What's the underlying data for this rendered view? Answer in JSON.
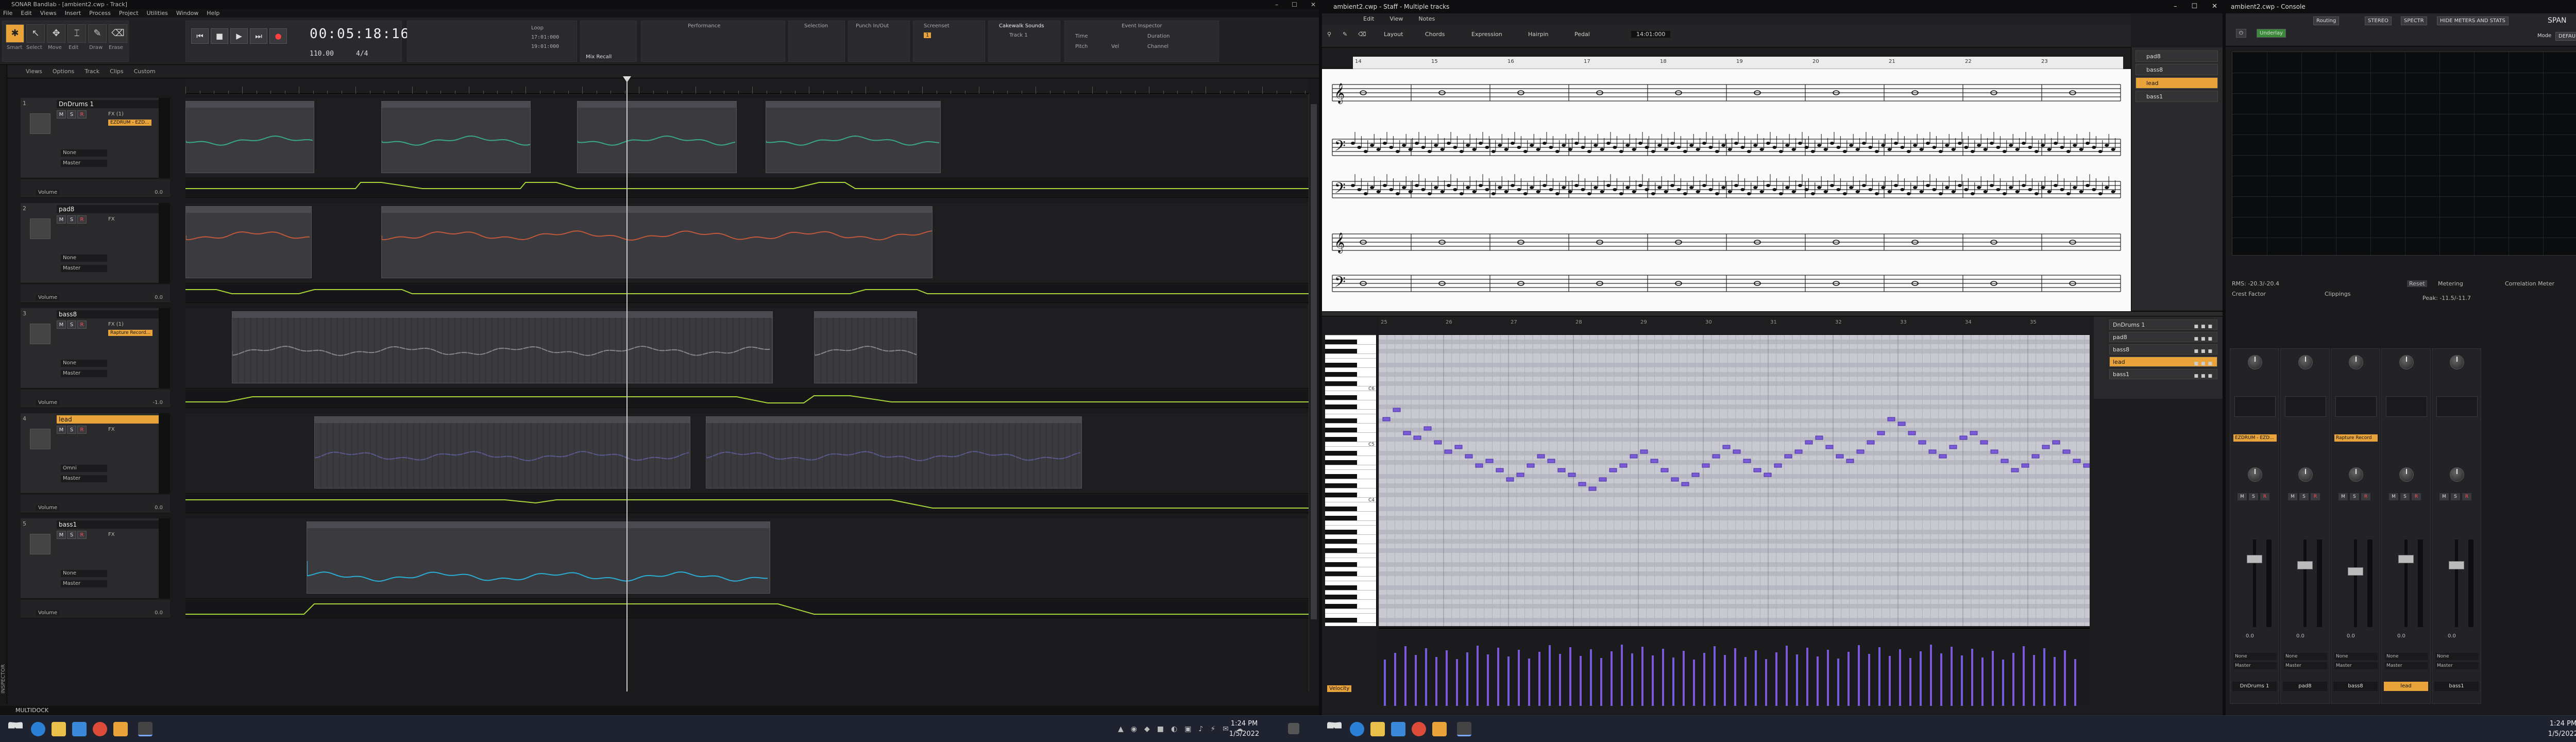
{
  "daw": {
    "title": "SONAR Bandlab - [ambient2.cwp - Track]",
    "menu": [
      "File",
      "Edit",
      "Views",
      "Insert",
      "Process",
      "Project",
      "Utilities",
      "Window",
      "Help"
    ],
    "tools": {
      "smart": "Smart",
      "select": "Select",
      "move": "Move",
      "edit": "Edit",
      "draw": "Draw",
      "erase": "Erase"
    },
    "transport": {
      "time": "00:05:18:16",
      "tempo": "110.00",
      "meter": "4/4",
      "loop_label": "Loop",
      "loop_start": "17:01:000",
      "loop_end": "19:01:000"
    },
    "control": {
      "mix_recall": "Mix Recall",
      "performance": "Performance",
      "selection": "Selection",
      "punch": "Punch In/Out",
      "screenset": "Screenset",
      "screenset_val": "1",
      "cakewalk": "Cakewalk Sounds",
      "track_label": "Track 1",
      "event_inspector": "Event Inspector",
      "time_lbl": "Time",
      "duration_lbl": "Duration",
      "pitch_lbl": "Pitch",
      "channel_lbl": "Channel",
      "vel_lbl": "Vel"
    },
    "view_menu": [
      "Views",
      "Options",
      "Track",
      "Clips",
      "Custom"
    ],
    "tracks": [
      {
        "num": "1",
        "name": "DnDrums 1",
        "plugin": "EZDRUM - EZD...",
        "fx": "FX (1)",
        "input": "None",
        "output": "Master",
        "auto_label": "Volume",
        "auto_val": "0.0"
      },
      {
        "num": "2",
        "name": "pad8",
        "plugin": "",
        "fx": "FX",
        "input": "None",
        "output": "Master",
        "auto_label": "Volume",
        "auto_val": "0.0"
      },
      {
        "num": "3",
        "name": "bass8",
        "plugin": "Rapture Record...",
        "fx": "FX (1)",
        "input": "None",
        "output": "Master",
        "auto_label": "Volume",
        "auto_val": "-1.0"
      },
      {
        "num": "4",
        "name": "lead",
        "plugin": "",
        "fx": "FX",
        "input": "Omni",
        "output": "Master",
        "auto_label": "Volume",
        "auto_val": "0.0"
      },
      {
        "num": "5",
        "name": "bass1",
        "plugin": "",
        "fx": "FX",
        "input": "None",
        "output": "Master",
        "auto_label": "Volume",
        "auto_val": "0.0"
      }
    ],
    "msr": {
      "mute": "M",
      "solo": "S",
      "rec": "R"
    },
    "status": "MULTIDOCK",
    "inspector": "INSPECTOR"
  },
  "staff": {
    "title": "ambient2.cwp - Staff - Multiple tracks",
    "menu": [
      "Edit",
      "View",
      "Notes"
    ],
    "tools": {
      "layout": "Layout",
      "chords": "Chords",
      "expression": "Expression",
      "hairpin": "Hairpin",
      "pedal": "Pedal"
    },
    "position": "14:01:000",
    "tracks": [
      "pad8",
      "bass8",
      "lead",
      "bass1"
    ],
    "selected": "lead",
    "bars": [
      "14",
      "15",
      "16",
      "17",
      "18",
      "19",
      "20",
      "21",
      "22",
      "23"
    ]
  },
  "pianoroll": {
    "tracks": [
      "DnDrums 1",
      "pad8",
      "bass8",
      "lead",
      "bass1"
    ],
    "selected": "lead",
    "bars": [
      "25",
      "26",
      "27",
      "28",
      "29",
      "30",
      "31",
      "32",
      "33",
      "34",
      "35"
    ],
    "vel_label": "Velocity",
    "c_labels": [
      "C6",
      "C5",
      "C4"
    ]
  },
  "console": {
    "title": "ambient2.cwp - Console",
    "span": {
      "name": "SPAN",
      "preset": "Underlay",
      "mode_label": "Mode",
      "mode": "DEFAULT",
      "routing": "Routing",
      "rms": "RMS: -20.3/-20.4",
      "peak": "Peak: -11.5/-11.7",
      "crest": "Crest Factor",
      "clippings": "Clippings",
      "corr": "Correlation Meter",
      "reset": "Reset",
      "metering": "Metering"
    },
    "toolbar_btns": [
      "STEREO",
      "SPECTR",
      "HIDE METERS AND STATS"
    ],
    "strips": [
      {
        "name": "DnDrums 1",
        "plugin": "EZDRUM - EZD...",
        "vol": "0.0",
        "sel": false
      },
      {
        "name": "pad8",
        "plugin": "",
        "vol": "0.0",
        "sel": false
      },
      {
        "name": "bass8",
        "plugin": "Rapture Record",
        "vol": "0.0",
        "sel": false
      },
      {
        "name": "lead",
        "plugin": "",
        "vol": "0.0",
        "sel": true
      },
      {
        "name": "bass1",
        "plugin": "",
        "vol": "0.0",
        "sel": false
      },
      {
        "name": "Master",
        "plugin": "Voxengo SPAN",
        "vol": "0.0",
        "sel": false
      }
    ],
    "strip_io": {
      "input": "None",
      "output": "Master"
    }
  },
  "taskbar": {
    "clock1_time": "1:24 PM",
    "clock1_date": "1/5/2022",
    "clock2_time": "1:24 PM",
    "clock2_date": "1/5/2022"
  },
  "colors": {
    "accent": "#e8a33a",
    "note": "#7a5ad6",
    "automation": "#a6d63a"
  }
}
